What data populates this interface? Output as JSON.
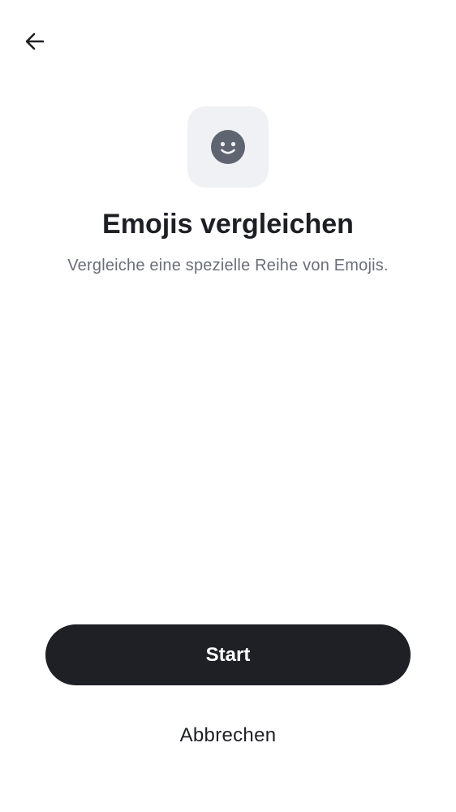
{
  "header": {
    "back_icon": "arrow-left-icon"
  },
  "hero": {
    "icon": "smiley-face-icon",
    "title": "Emojis vergleichen",
    "subtitle": "Vergleiche eine spezielle Reihe von Emojis."
  },
  "actions": {
    "start_label": "Start",
    "cancel_label": "Abbrechen"
  },
  "colors": {
    "primary_button": "#1f2026",
    "icon_tile_bg": "#f0f1f5",
    "icon_fill": "#5f6570",
    "subtitle_text": "#6a6e79"
  }
}
